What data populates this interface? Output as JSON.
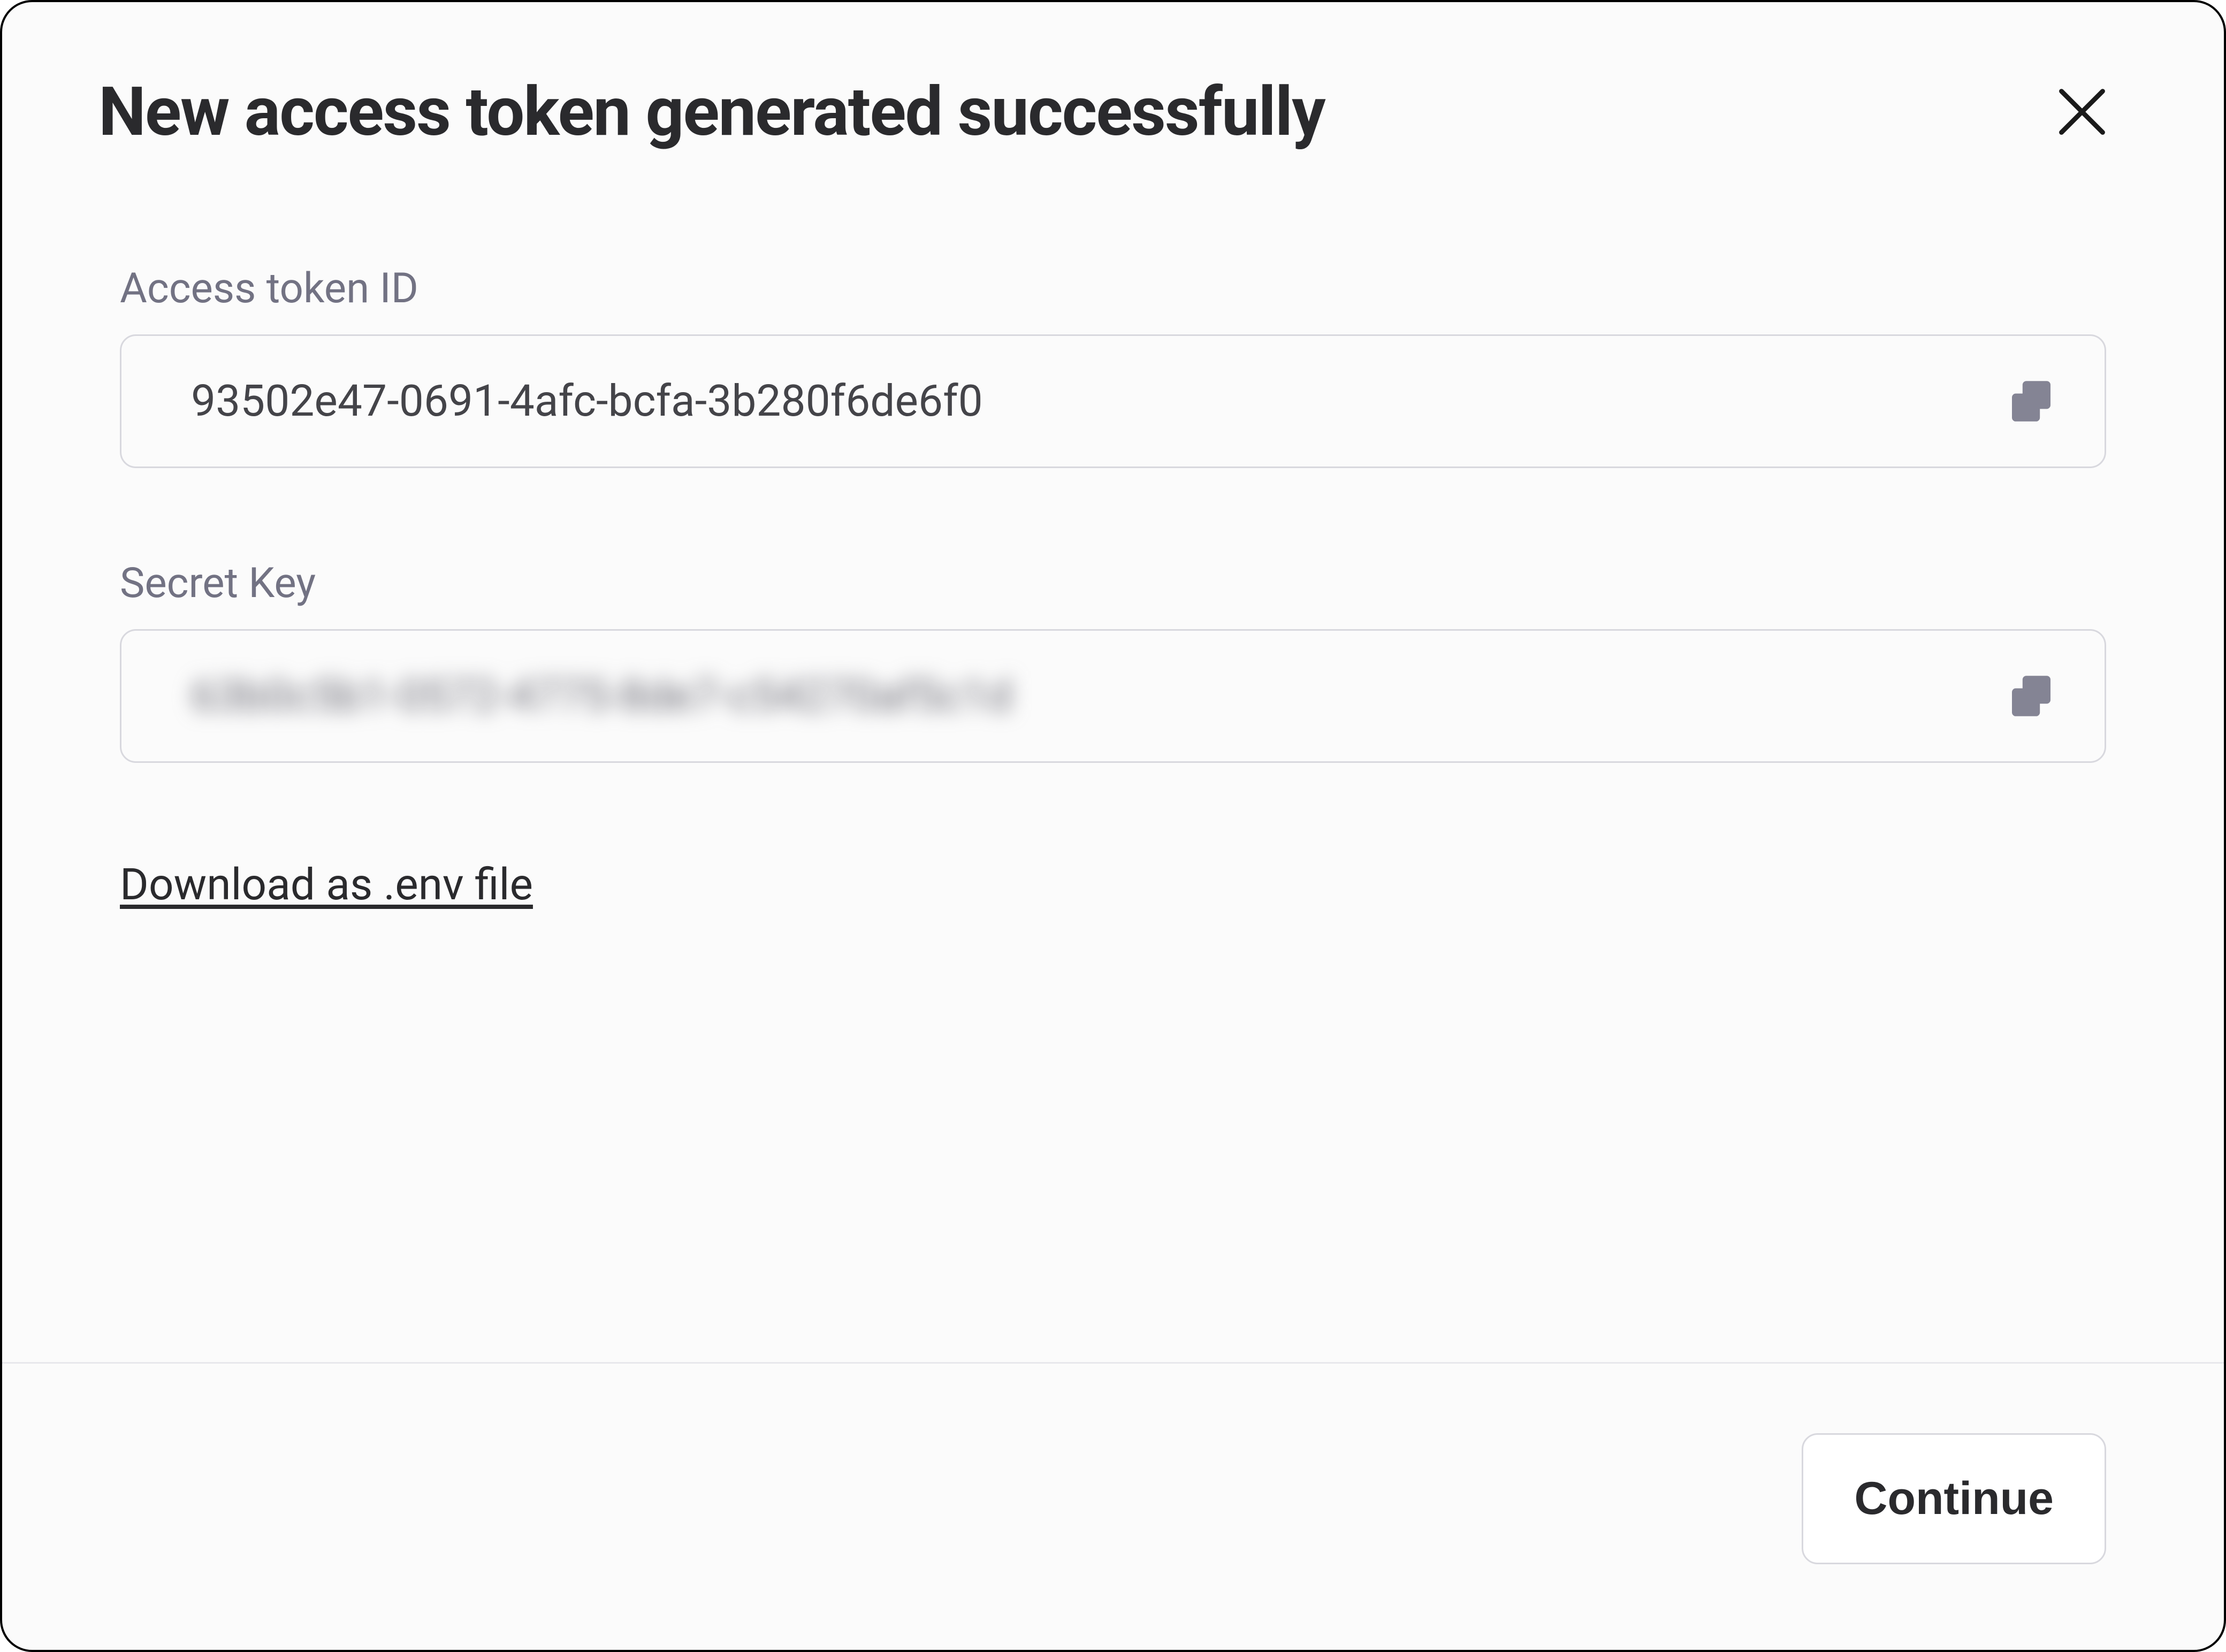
{
  "modal": {
    "title": "New access token generated successfully",
    "fields": {
      "access_token_id": {
        "label": "Access token ID",
        "value": "93502e47-0691-4afc-bcfa-3b280f6de6f0"
      },
      "secret_key": {
        "label": "Secret Key",
        "value": "63b0c5b1-0572-4775-8de7-c54270af5c1d"
      }
    },
    "download_link": "Download as .env file",
    "continue_button": "Continue"
  }
}
